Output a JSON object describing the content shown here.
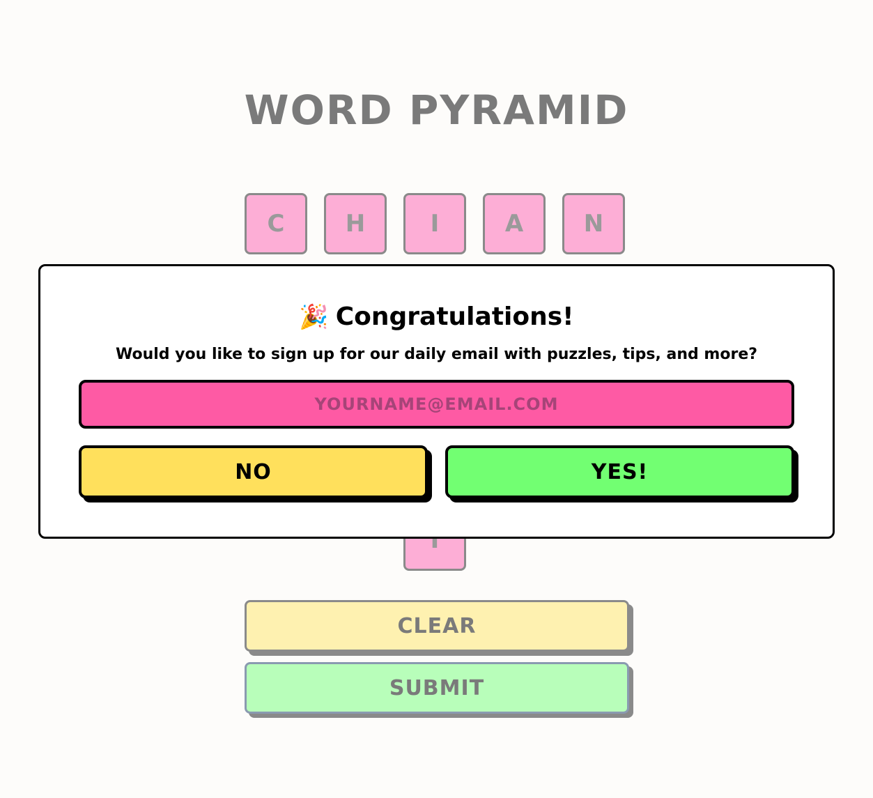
{
  "game": {
    "title": "WORD PYRAMID",
    "top_row_letters": [
      "C",
      "H",
      "I",
      "A",
      "N"
    ],
    "bottom_tile_letter": "I",
    "clear_label": "CLEAR",
    "submit_label": "SUBMIT"
  },
  "modal": {
    "emoji": "🎉",
    "title": "Congratulations!",
    "subtitle": "Would you like to sign up for our daily email with puzzles, tips, and more?",
    "email_placeholder": "YOURNAME@EMAIL.COM",
    "email_value": "",
    "no_label": "NO",
    "yes_label": "YES!"
  },
  "colors": {
    "background": "#fdfcfa",
    "tile": "#fdaed6",
    "input": "#fe5aa4",
    "no_button": "#ffe05c",
    "yes_button": "#72ff72",
    "clear_button": "#fef1b0",
    "submit_button": "#b8feba"
  }
}
